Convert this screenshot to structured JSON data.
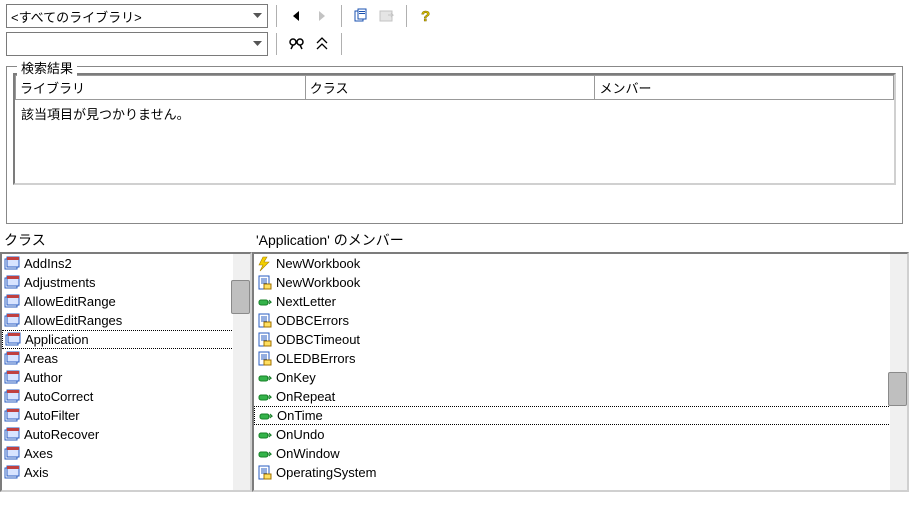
{
  "toolbar": {
    "library_combo": "<すべてのライブラリ>",
    "search_combo": ""
  },
  "search": {
    "legend": "検索結果",
    "cols": [
      "ライブラリ",
      "クラス",
      "メンバー"
    ],
    "empty_msg": "該当項目が見つかりません。"
  },
  "classes": {
    "title": "クラス",
    "selected": "Application",
    "items": [
      {
        "name": "AddIns2",
        "icon": "class"
      },
      {
        "name": "Adjustments",
        "icon": "class"
      },
      {
        "name": "AllowEditRange",
        "icon": "class"
      },
      {
        "name": "AllowEditRanges",
        "icon": "class"
      },
      {
        "name": "Application",
        "icon": "class"
      },
      {
        "name": "Areas",
        "icon": "class"
      },
      {
        "name": "Author",
        "icon": "class"
      },
      {
        "name": "AutoCorrect",
        "icon": "class"
      },
      {
        "name": "AutoFilter",
        "icon": "class"
      },
      {
        "name": "AutoRecover",
        "icon": "class"
      },
      {
        "name": "Axes",
        "icon": "class"
      },
      {
        "name": "Axis",
        "icon": "class"
      }
    ]
  },
  "members": {
    "title": "'Application' のメンバー",
    "selected": "OnTime",
    "items": [
      {
        "name": "NewWorkbook",
        "icon": "event"
      },
      {
        "name": "NewWorkbook",
        "icon": "prop"
      },
      {
        "name": "NextLetter",
        "icon": "method"
      },
      {
        "name": "ODBCErrors",
        "icon": "prop"
      },
      {
        "name": "ODBCTimeout",
        "icon": "prop"
      },
      {
        "name": "OLEDBErrors",
        "icon": "prop"
      },
      {
        "name": "OnKey",
        "icon": "method"
      },
      {
        "name": "OnRepeat",
        "icon": "method"
      },
      {
        "name": "OnTime",
        "icon": "method"
      },
      {
        "name": "OnUndo",
        "icon": "method"
      },
      {
        "name": "OnWindow",
        "icon": "method"
      },
      {
        "name": "OperatingSystem",
        "icon": "prop"
      }
    ]
  }
}
